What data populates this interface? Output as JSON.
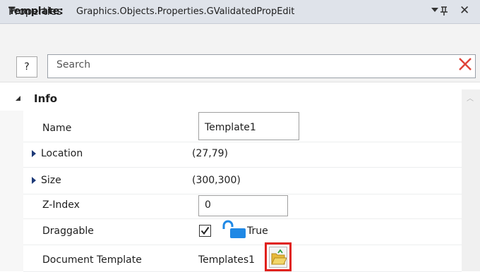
{
  "panel": {
    "title": "Properties",
    "close_glyph": "✕",
    "pin_glyph": "ꟷ"
  },
  "template": {
    "label": "Template:",
    "value": "Graphics.Objects.Properties.GValidatedPropEdit"
  },
  "search": {
    "help_label": "?",
    "placeholder": "Search"
  },
  "category": {
    "label": "Info"
  },
  "rows": [
    {
      "name": "Name",
      "value": "Template1"
    },
    {
      "name": "Location",
      "value": "(27,79)"
    },
    {
      "name": "Size",
      "value": "(300,300)"
    },
    {
      "name": "Z-Index",
      "value": "0"
    },
    {
      "name": "Draggable",
      "value": "True",
      "checked": true
    },
    {
      "name": "Document Template",
      "value": "Templates1"
    }
  ],
  "colors": {
    "clear_red": "#e0443a",
    "lock_blue": "#1f88e5",
    "highlight_red": "#e0201b",
    "folder_yellow": "#f2c94c"
  },
  "icons": [
    "collapse-triangle-icon",
    "expand-triangle-icon",
    "unlocked-padlock-icon",
    "folder-open-icon",
    "clear-search-icon",
    "scroll-up-icon"
  ]
}
